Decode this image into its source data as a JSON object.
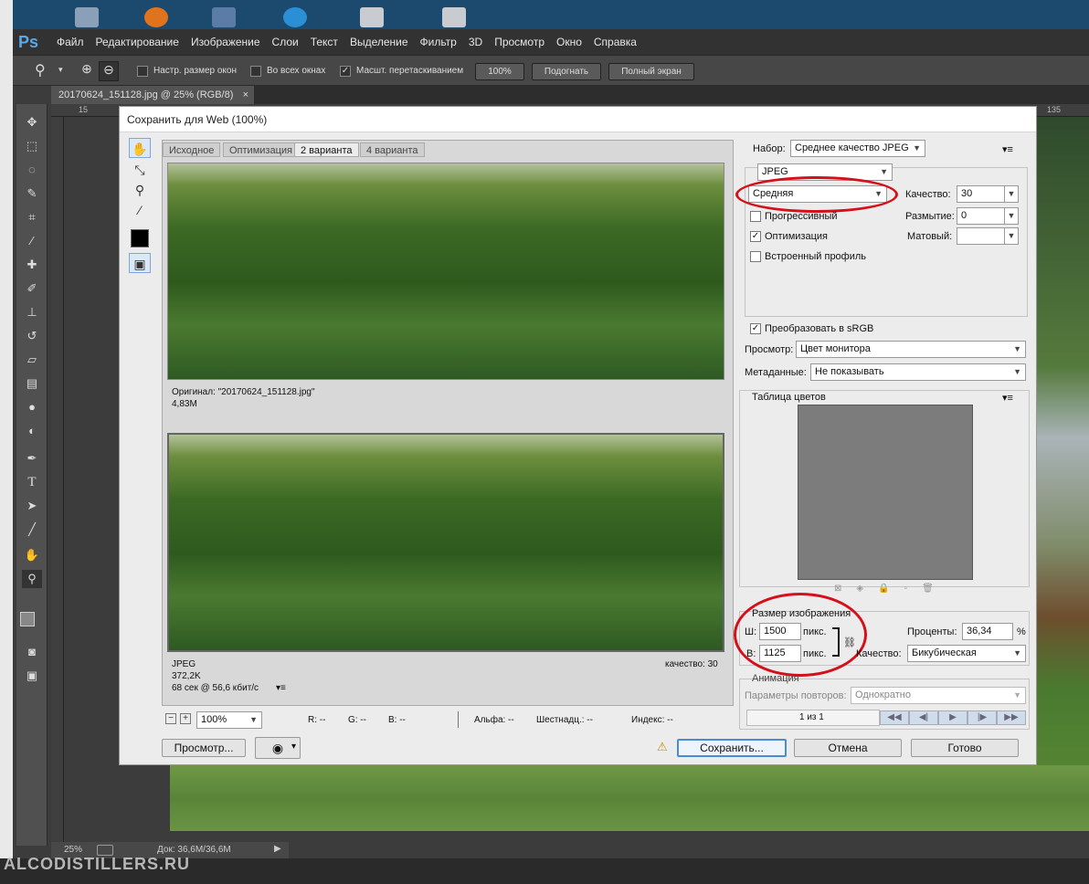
{
  "menu": [
    "Файл",
    "Редактирование",
    "Изображение",
    "Слои",
    "Текст",
    "Выделение",
    "Фильтр",
    "3D",
    "Просмотр",
    "Окно",
    "Справка"
  ],
  "app_logo": "Ps",
  "options_bar": {
    "resize_windows_label": "Настр. размер окон",
    "all_windows_label": "Во всех окнах",
    "scrubby_zoom_label": "Масшт. перетаскиванием",
    "btn_100": "100%",
    "btn_fit": "Подогнать",
    "btn_fullscreen": "Полный экран"
  },
  "document_tab": {
    "title": "20170624_151128.jpg @ 25% (RGB/8)",
    "close": "×"
  },
  "ruler_top": {
    "left": "15",
    "right": "135"
  },
  "status": {
    "zoom": "25%",
    "doc": "Док: 36,6М/36,6М"
  },
  "watermark": "ALCODISTILLERS.RU",
  "dialog": {
    "title": "Сохранить для Web (100%)",
    "tabs": [
      "Исходное",
      "Оптимизация",
      "2 варианта",
      "4 варианта"
    ],
    "active_tab": "2 варианта",
    "original_info": {
      "name": "Оригинал: \"20170624_151128.jpg\"",
      "size": "4,83M"
    },
    "optimized_info": {
      "format": "JPEG",
      "size": "372,2K",
      "time": "68 сек @ 56,6 кбит/с",
      "quality": "качество: 30"
    },
    "bottom_bar": {
      "zoom": "100%",
      "r": "R: --",
      "g": "G: --",
      "b": "B: --",
      "alpha": "Альфа: --",
      "hex": "Шестнадц.: --",
      "index": "Индекс: --"
    },
    "preset": {
      "label": "Набор:",
      "value": "Среднее качество JPEG"
    },
    "format": "JPEG",
    "quality_level": "Средняя",
    "quality": {
      "label": "Качество:",
      "value": "30"
    },
    "blur": {
      "label": "Размытие:",
      "value": "0"
    },
    "matte": {
      "label": "Матовый:",
      "value": ""
    },
    "progressive": {
      "label": "Прогрессивный",
      "checked": false
    },
    "optimized": {
      "label": "Оптимизация",
      "checked": true
    },
    "embed_profile": {
      "label": "Встроенный профиль",
      "checked": false
    },
    "convert_srgb": {
      "label": "Преобразовать в sRGB",
      "checked": true
    },
    "preview": {
      "label": "Просмотр:",
      "value": "Цвет монитора"
    },
    "metadata": {
      "label": "Метаданные:",
      "value": "Не показывать"
    },
    "color_table": {
      "title": "Таблица цветов"
    },
    "image_size": {
      "title": "Размер изображения",
      "w_label": "Ш:",
      "w_value": "1500",
      "w_unit": "пикс.",
      "h_label": "В:",
      "h_value": "1125",
      "h_unit": "пикс.",
      "percent_label": "Проценты:",
      "percent_value": "36,34",
      "percent_unit": "%",
      "quality_label": "Качество:",
      "quality_value": "Бикубическая"
    },
    "animation": {
      "title": "Анимация",
      "loop_label": "Параметры повторов:",
      "loop_value": "Однократно",
      "counter": "1 из 1"
    },
    "buttons": {
      "preview": "Просмотр...",
      "save": "Сохранить...",
      "cancel": "Отмена",
      "done": "Готово"
    },
    "check_mark": "✓"
  },
  "colors": {
    "ps_blue": "#5aa8e6",
    "highlight": "#d4101a",
    "dialog_bg": "#ececec"
  }
}
